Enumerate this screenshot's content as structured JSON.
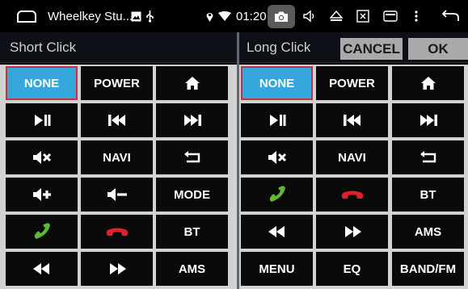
{
  "status_bar": {
    "app_title": "Wheelkey Stu...",
    "time": "01:20"
  },
  "panels": {
    "short_click": {
      "label": "Short Click",
      "buttons": [
        {
          "label": "NONE",
          "selected": true
        },
        {
          "label": "POWER"
        },
        {
          "icon": "home-icon"
        },
        {
          "icon": "play-pause-icon"
        },
        {
          "icon": "previous-track-icon"
        },
        {
          "icon": "next-track-icon"
        },
        {
          "icon": "mute-icon"
        },
        {
          "label": "NAVI"
        },
        {
          "icon": "back-return-icon"
        },
        {
          "icon": "volume-up-icon"
        },
        {
          "icon": "volume-down-icon"
        },
        {
          "label": "MODE"
        },
        {
          "icon": "phone-answer-icon"
        },
        {
          "icon": "phone-hangup-icon"
        },
        {
          "label": "BT"
        },
        {
          "icon": "rewind-icon"
        },
        {
          "icon": "fast-forward-icon"
        },
        {
          "label": "AMS"
        }
      ]
    },
    "long_click": {
      "label": "Long Click",
      "cancel_label": "CANCEL",
      "ok_label": "OK",
      "buttons": [
        {
          "label": "NONE",
          "selected": true
        },
        {
          "label": "POWER"
        },
        {
          "icon": "home-icon"
        },
        {
          "icon": "play-pause-icon"
        },
        {
          "icon": "previous-track-icon"
        },
        {
          "icon": "next-track-icon"
        },
        {
          "icon": "mute-icon"
        },
        {
          "label": "NAVI"
        },
        {
          "icon": "back-return-icon"
        },
        {
          "icon": "phone-answer-icon"
        },
        {
          "icon": "phone-hangup-icon"
        },
        {
          "label": "BT"
        },
        {
          "icon": "rewind-icon"
        },
        {
          "icon": "fast-forward-icon"
        },
        {
          "label": "AMS"
        },
        {
          "label": "MENU"
        },
        {
          "label": "EQ"
        },
        {
          "label": "BAND/FM"
        }
      ]
    }
  },
  "colors": {
    "selected_bg": "#35a7dc",
    "selected_border": "#cc3040",
    "answer_green": "#5fb832",
    "hangup_red": "#e0202a"
  }
}
